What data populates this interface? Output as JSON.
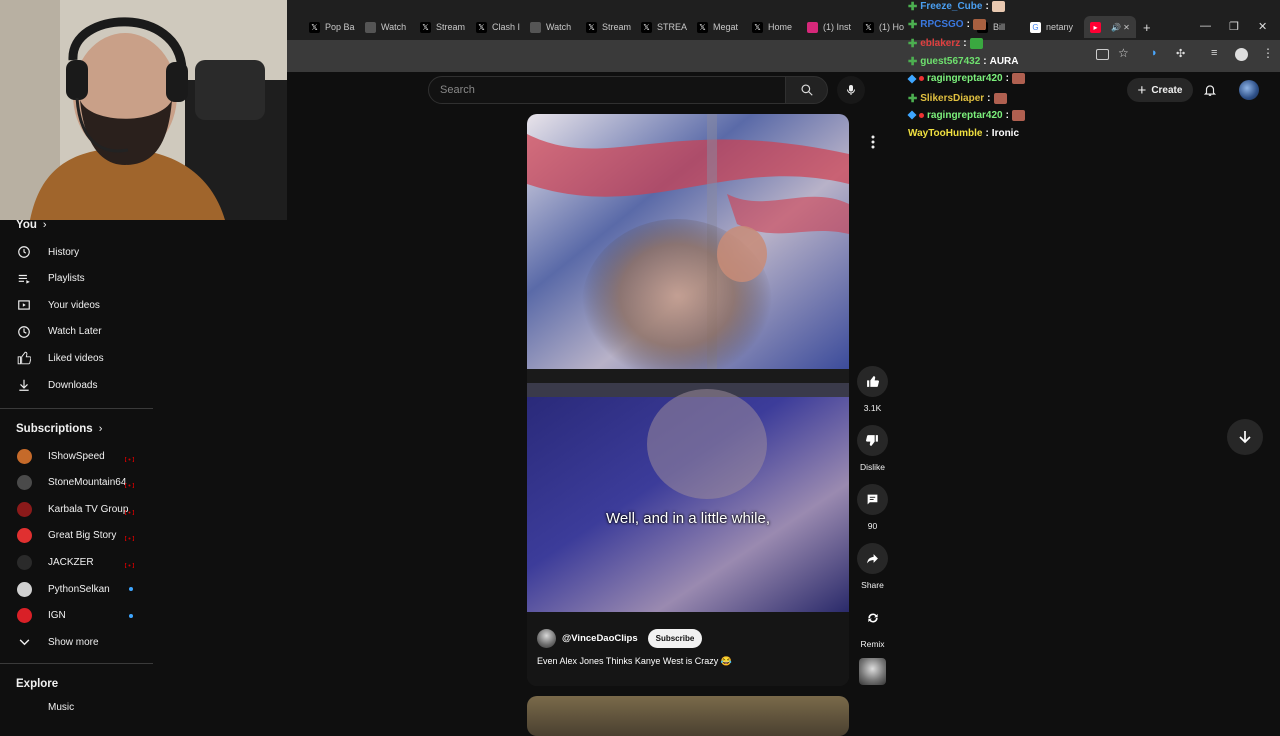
{
  "browser": {
    "tabs": [
      {
        "label": "Pop Ba",
        "icon": "x-icon"
      },
      {
        "label": "Watch",
        "icon": "globe-icon"
      },
      {
        "label": "Stream",
        "icon": "x-icon"
      },
      {
        "label": "Clash I",
        "icon": "x-icon"
      },
      {
        "label": "Watch",
        "icon": "globe-icon"
      },
      {
        "label": "Stream",
        "icon": "x-icon"
      },
      {
        "label": "STREA",
        "icon": "x-icon"
      },
      {
        "label": "Megat",
        "icon": "x-icon"
      },
      {
        "label": "Home",
        "icon": "x-icon"
      },
      {
        "label": "(1) Inst",
        "icon": "instagram-icon"
      },
      {
        "label": "(1) Ho",
        "icon": "x-icon"
      },
      {
        "label": "Bill",
        "icon": "x-icon"
      },
      {
        "label": "netany",
        "icon": "google-icon"
      },
      {
        "label": "",
        "icon": "youtube-icon"
      }
    ],
    "new_tab": "+"
  },
  "header": {
    "search_placeholder": "Search",
    "create_label": "Create"
  },
  "sidebar": {
    "you_label": "You",
    "you_items": [
      {
        "label": "History",
        "icon": "history-icon"
      },
      {
        "label": "Playlists",
        "icon": "playlists-icon"
      },
      {
        "label": "Your videos",
        "icon": "your-videos-icon"
      },
      {
        "label": "Watch Later",
        "icon": "watch-later-icon"
      },
      {
        "label": "Liked videos",
        "icon": "liked-videos-icon"
      },
      {
        "label": "Downloads",
        "icon": "downloads-icon"
      }
    ],
    "subscriptions_label": "Subscriptions",
    "subscriptions": [
      {
        "label": "IShowSpeed",
        "avatar_color": "#c56a2a",
        "status": "live"
      },
      {
        "label": "StoneMountain64",
        "avatar_color": "#4a4a4a",
        "status": "live"
      },
      {
        "label": "Karbala TV Group",
        "avatar_color": "#8b1a1a",
        "status": "live"
      },
      {
        "label": "Great Big Story",
        "avatar_color": "#e03030",
        "status": "live"
      },
      {
        "label": "JACKZER",
        "avatar_color": "#2a2a2a",
        "status": "live"
      },
      {
        "label": "PythonSelkan",
        "avatar_color": "#d0d0d0",
        "status": "new"
      },
      {
        "label": "IGN",
        "avatar_color": "#d92027",
        "status": "new"
      }
    ],
    "show_more_label": "Show more",
    "explore_label": "Explore",
    "explore_first": "Music"
  },
  "short": {
    "caption": "Well, and in a little while,",
    "channel": "@VinceDaoClips",
    "subscribe_label": "Subscribe",
    "title": "Even Alex Jones Thinks Kanye West is Crazy 😂"
  },
  "actions": {
    "like_count": "3.1K",
    "dislike_label": "Dislike",
    "comments_count": "90",
    "share_label": "Share",
    "remix_label": "Remix"
  },
  "chat": [
    {
      "user": "Freeze_Cube",
      "color": "#4a9ef0",
      "msg": "",
      "badge": "green",
      "emote": true
    },
    {
      "user": "RPCSGO",
      "color": "#3a78e0",
      "msg": "",
      "badge": "green",
      "emote": true
    },
    {
      "user": "eblakerz",
      "color": "#e04040",
      "msg": "",
      "badge": "green",
      "emote": true
    },
    {
      "user": "guest567432",
      "color": "#6ee06e",
      "msg": "AURA",
      "badge": "green",
      "emote": false
    },
    {
      "user": "ragingreptar420",
      "color": "#7cf07c",
      "msg": "",
      "badge": "blue",
      "emote": true
    },
    {
      "user": "SlikersDiaper",
      "color": "#e0c040",
      "msg": "",
      "badge": "green",
      "emote": true
    },
    {
      "user": "ragingreptar420",
      "color": "#7cf07c",
      "msg": "",
      "badge": "blue",
      "emote": true
    },
    {
      "user": "WayTooHumble",
      "color": "#f0e040",
      "msg": "Ironic",
      "badge": "none",
      "emote": false
    }
  ],
  "colors": {
    "background": "#0f0f0f",
    "live": "#cc0000",
    "new_dot": "#3ea6ff"
  }
}
